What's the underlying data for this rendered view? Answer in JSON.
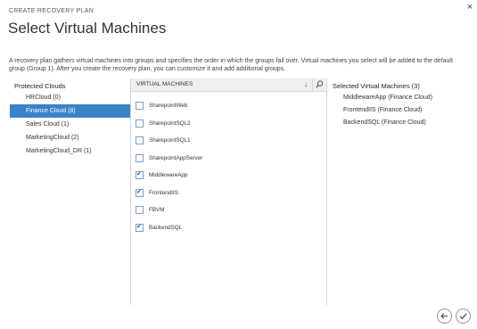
{
  "dialog": {
    "close_glyph": "×",
    "wizard_label": "CREATE RECOVERY PLAN",
    "title": "Select Virtual Machines",
    "description": "A recovery plan gathers virtual machines into groups and specifies the order in which the groups fail over. Virtual machines you select will be added to the default group (Group 1). After you create the recovery plan, you can customize it and add additional groups."
  },
  "protected_clouds": {
    "heading": "Protected Clouds",
    "items": [
      {
        "label": "HRCloud (0)",
        "selected": false
      },
      {
        "label": "Finance Cloud (8)",
        "selected": true
      },
      {
        "label": "Sales Cloud (1)",
        "selected": false
      },
      {
        "label": "MarketingCloud (2)",
        "selected": false
      },
      {
        "label": "MarketingCloud_DR (1)",
        "selected": false
      }
    ]
  },
  "vm_panel": {
    "header": "VIRTUAL MACHINES",
    "sort_glyph": "↓",
    "icons": {
      "sort": "sort-down-icon",
      "search": "search-icon"
    },
    "items": [
      {
        "label": "SharepointWeb",
        "checked": false
      },
      {
        "label": "SharepointSQL2",
        "checked": false
      },
      {
        "label": "SharepointSQL1",
        "checked": false
      },
      {
        "label": "SharepointAppServer",
        "checked": false
      },
      {
        "label": "MiddlewareApp",
        "checked": true
      },
      {
        "label": "FrontendIIS",
        "checked": true
      },
      {
        "label": "FBVM",
        "checked": false
      },
      {
        "label": "BackendSQL",
        "checked": true
      }
    ]
  },
  "selected_vms": {
    "heading": "Selected Virtual Machines (3)",
    "items": [
      "MiddlewareApp (Finance Cloud)",
      "FrontendIIS (Finance Cloud)",
      "BackendSQL (Finance Cloud)"
    ]
  },
  "footer": {
    "icons": {
      "back": "back-arrow-icon",
      "finish": "checkmark-icon"
    }
  },
  "colors": {
    "selection": "#3a83c8",
    "checkbox_border": "#7e9fc2",
    "checkmark": "#2b5d9c",
    "header_bg": "#efefef"
  }
}
